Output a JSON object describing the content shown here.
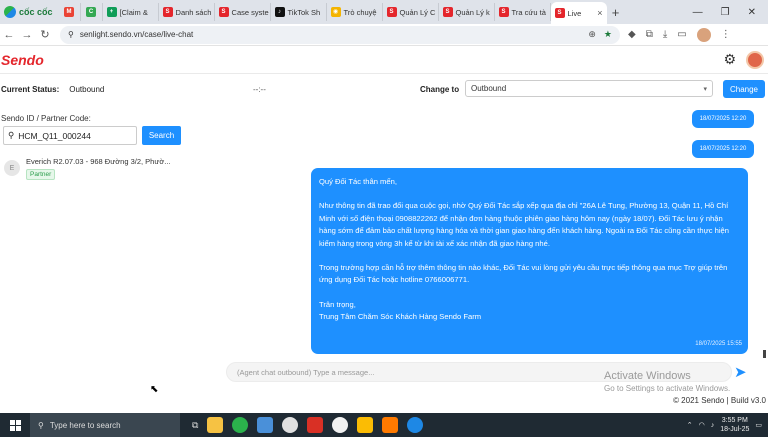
{
  "browser": {
    "brand": "cốc cốc",
    "tabs": [
      {
        "label": "",
        "fav": "M",
        "color": "#ea4335"
      },
      {
        "label": "",
        "fav": "C",
        "color": "#34a853"
      },
      {
        "label": "[Claim &",
        "fav": "+",
        "color": "#0f9d58"
      },
      {
        "label": "Danh sách",
        "fav": "S",
        "color": "#e4262c"
      },
      {
        "label": "Case syste",
        "fav": "S",
        "color": "#e4262c"
      },
      {
        "label": "TikTok Sh",
        "fav": "♪",
        "color": "#111111"
      },
      {
        "label": "Trò chuyệ",
        "fav": "◉",
        "color": "#f4b400"
      },
      {
        "label": "Quản Lý C",
        "fav": "S",
        "color": "#e4262c"
      },
      {
        "label": "Quản Lý k",
        "fav": "S",
        "color": "#e4262c"
      },
      {
        "label": "Tra cứu tà",
        "fav": "S",
        "color": "#e4262c"
      },
      {
        "label": "Live",
        "fav": "S",
        "color": "#e4262c",
        "active": true
      }
    ],
    "url": "senlight.sendo.vn/case/live-chat"
  },
  "app": {
    "logo": "Sendo",
    "current_status_label": "Current Status:",
    "current_status_value": "Outbound",
    "timer": "--:--",
    "change_to_label": "Change to",
    "change_to_value": "Outbound",
    "change_button": "Change"
  },
  "left": {
    "search_label": "Sendo ID / Partner Code:",
    "search_value": "HCM_Q11_000244",
    "search_button": "Search",
    "contact": {
      "initial": "E",
      "name": "Everich R2.07.03 - 968 Đường 3/2, Phườ...",
      "badge": "Partner"
    }
  },
  "chat": {
    "pills": [
      "18/07/2025 12:20",
      "18/07/2025 12:20"
    ],
    "message": {
      "p1": "Quý Đối Tác thân mến,",
      "p2": "Như thông tin đã trao đổi qua cuộc gọi, nhờ Quý Đối Tác sắp xếp qua địa chỉ \"26A Lê Tung, Phường 13, Quận 11, Hồ Chí Minh với số điện thoại 0908822262 để nhận đơn hàng thuộc phiên giao hàng hôm nay (ngày 18/07). Đối Tác lưu ý nhận hàng sớm để đảm bảo chất lượng hàng hóa và thời gian giao hàng đến khách hàng. Ngoài ra Đối Tác cũng cần thực hiện kiểm hàng trong vòng 3h kể từ khi tài xế xác nhận đã giao hàng nhé.",
      "p3": "Trong trường hợp cần hỗ trợ thêm thông tin nào khác, Đối Tác vui lòng gửi yêu cầu trực tiếp thông qua mục Trợ giúp trên ứng dụng Đối Tác hoặc hotline 0766006771.",
      "p4a": "Trân trọng,",
      "p4b": "Trung Tâm Chăm Sóc Khách Hàng Sendo Farm",
      "timestamp": "18/07/2025 15:55"
    },
    "input_placeholder": "(Agent chat outbound) Type a message..."
  },
  "watermark": {
    "line1": "Activate Windows",
    "line2": "Go to Settings to activate Windows."
  },
  "footer": "© 2021 Sendo | Build v3.0",
  "taskbar": {
    "search_placeholder": "Type here to search",
    "time": "3:55 PM",
    "date": "18-Jul-25"
  }
}
